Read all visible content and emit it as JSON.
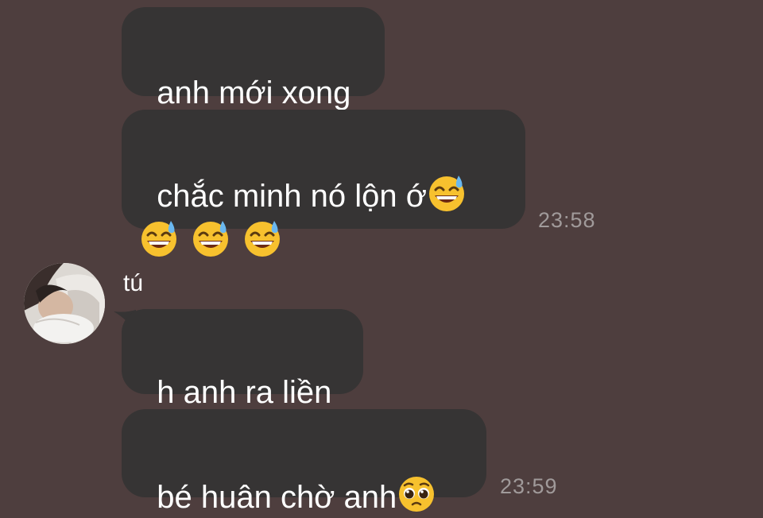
{
  "messages": [
    {
      "text": "anh mới xong"
    },
    {
      "text": "chắc minh nó lộn ớ",
      "emoji_trailing": "grinning-sweat-emoji",
      "emoji_row": [
        "grinning-sweat-emoji",
        "grinning-sweat-emoji",
        "grinning-sweat-emoji"
      ],
      "time": "23:58"
    },
    {
      "sender": "tú",
      "text": "h anh ra liền"
    },
    {
      "text": "bé huân chờ anh",
      "emoji_trailing": "pleading-face-emoji",
      "time": "23:59"
    }
  ],
  "colors": {
    "background": "#4e3e3e",
    "bubble": "#363434",
    "text": "#ffffff",
    "timestamp": "#a09a9a"
  }
}
